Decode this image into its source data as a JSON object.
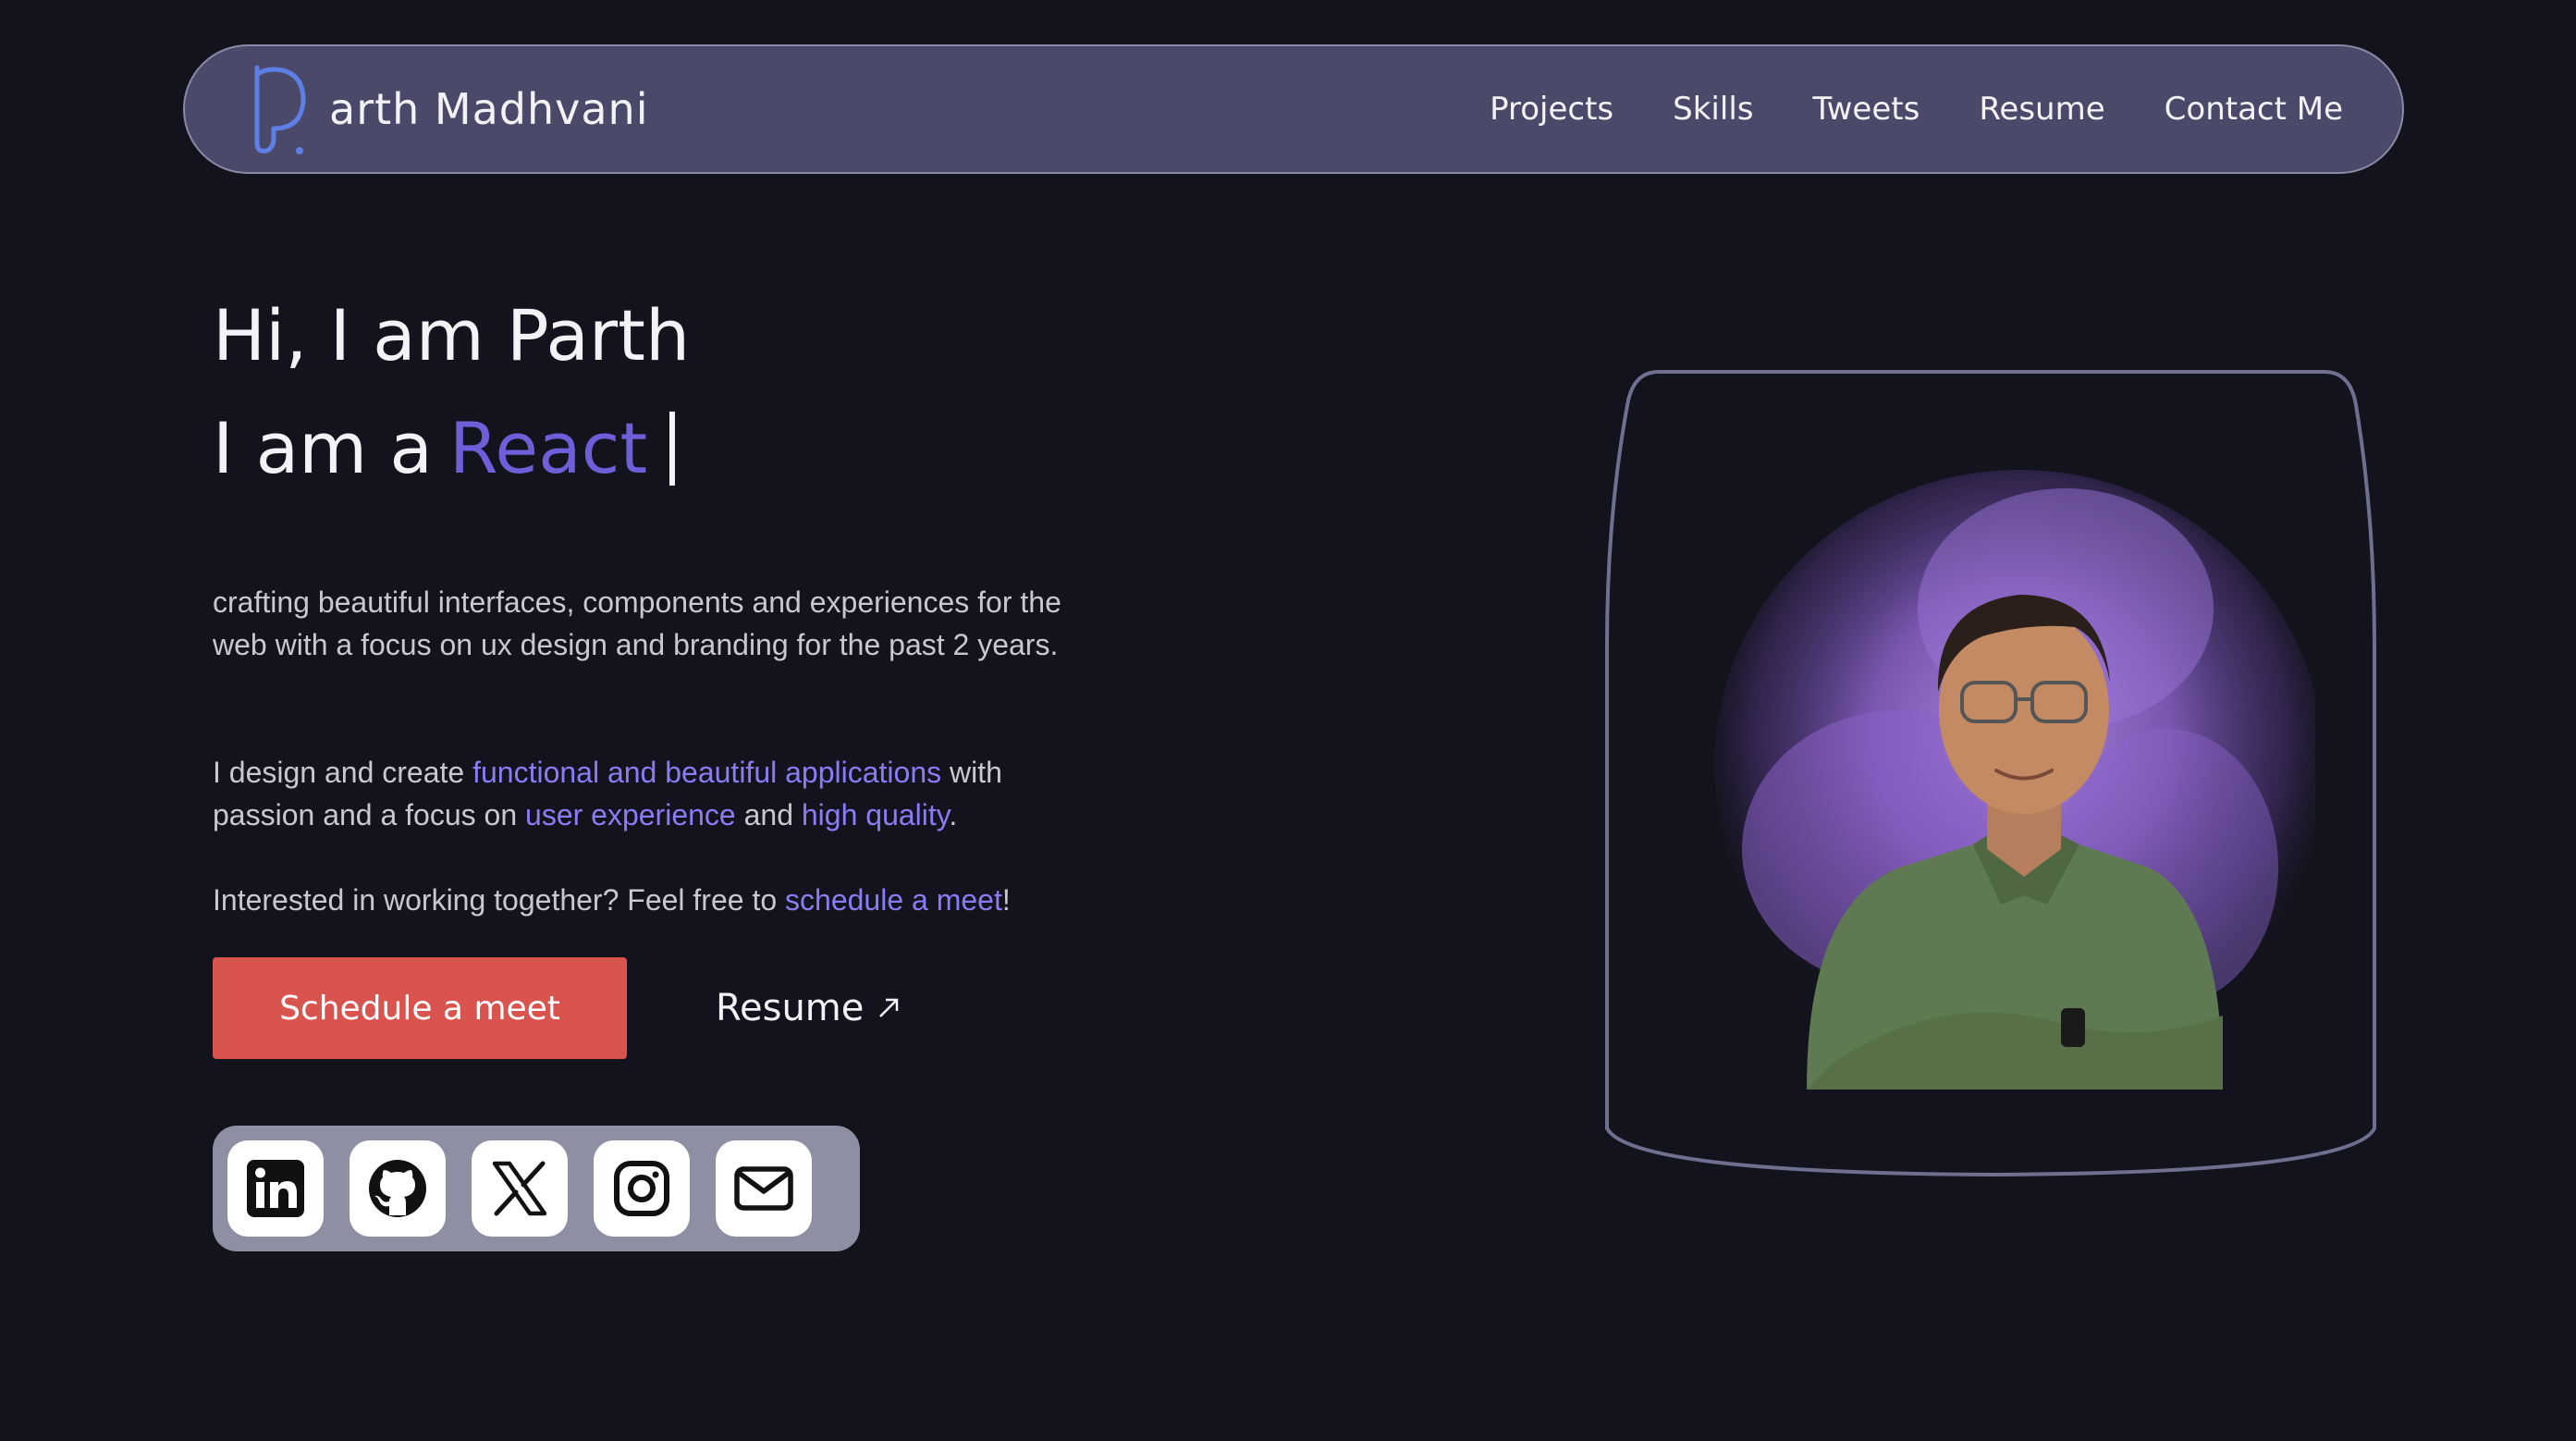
{
  "navbar": {
    "brand_name": "arth Madhvani",
    "links": [
      "Projects",
      "Skills",
      "Tweets",
      "Resume",
      "Contact Me"
    ]
  },
  "hero": {
    "greeting": "Hi, I am Parth",
    "role_prefix": "I am a",
    "role_word": "React"
  },
  "about": {
    "p1": "crafting beautiful interfaces, components and experiences for the web with a focus on ux design and branding for the past 2 years.",
    "p2_a": "I design and create ",
    "p2_hl1": "functional and beautiful applications",
    "p2_b": " with passion and a focus on ",
    "p2_hl2": "user experience",
    "p2_c": " and ",
    "p2_hl3": "high quality",
    "p2_d": ".",
    "p3_a": "Interested in working together? Feel free to ",
    "p3_hl": "schedule a meet",
    "p3_b": "!"
  },
  "actions": {
    "primary_label": "Schedule a meet",
    "secondary_label": "Resume",
    "secondary_icon": "external-arrow-icon"
  },
  "social": [
    "linkedin-icon",
    "github-icon",
    "x-icon",
    "instagram-icon",
    "mail-icon"
  ],
  "colors": {
    "background": "#13131d",
    "navbar": "#4b4969",
    "accent": "#6e5fd8",
    "link_highlight": "#8b7cf6",
    "primary_button": "#d9534f",
    "portrait_glow": "#8a63c9",
    "shirt": "#5f7a52"
  }
}
